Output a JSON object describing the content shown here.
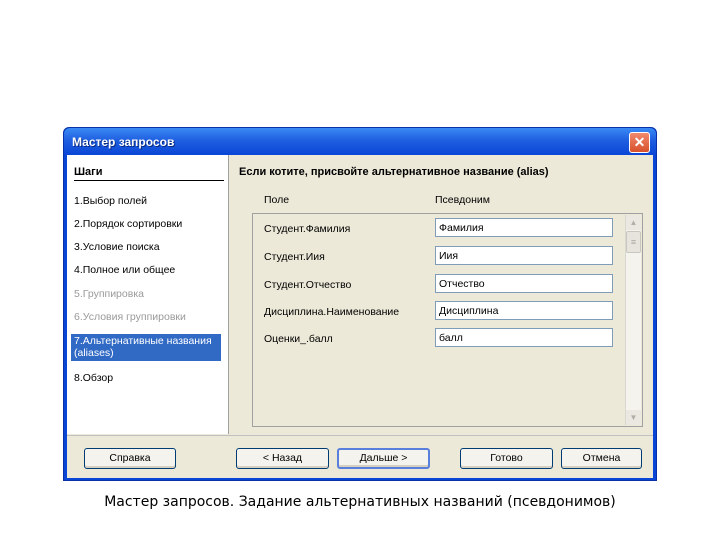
{
  "window": {
    "title": "Мастер запросов",
    "close_glyph": "✕"
  },
  "steps": {
    "title": "Шаги",
    "items": [
      {
        "label": "1.Выбор полей",
        "state": "normal"
      },
      {
        "label": "2.Порядок сортировки",
        "state": "normal"
      },
      {
        "label": "3.Условие поиска",
        "state": "normal"
      },
      {
        "label": "4.Полное или общее",
        "state": "normal"
      },
      {
        "label": "5.Группировка",
        "state": "disabled"
      },
      {
        "label": "6.Условия группировки",
        "state": "disabled"
      },
      {
        "label": "7.Альтернативные названия (aliases)",
        "state": "active"
      },
      {
        "label": "8.Обзор",
        "state": "normal"
      }
    ]
  },
  "main": {
    "heading": "Если котите, присвойте альтернативное название (alias)",
    "col_field": "Поле",
    "col_alias": "Псевдоним",
    "rows": [
      {
        "field": "Студент.Фамилия",
        "alias": "Фамилия"
      },
      {
        "field": "Студент.Иия",
        "alias": "Иия"
      },
      {
        "field": "Студент.Отчество",
        "alias": "Отчество"
      },
      {
        "field": "Дисциплина.Наименование",
        "alias": "Дисциплина"
      },
      {
        "field": "Оценки_.балл",
        "alias": "балл"
      }
    ]
  },
  "buttons": {
    "help": "Справка",
    "back": "< Назад",
    "next": "Дальше >",
    "finish": "Готово",
    "cancel": "Отмена"
  },
  "caption": "Мастер запросов. Задание альтернативных названий (псевдонимов)",
  "colors": {
    "titlebar": "#0a46d6",
    "selection": "#316ac5",
    "client": "#ece9d8"
  }
}
